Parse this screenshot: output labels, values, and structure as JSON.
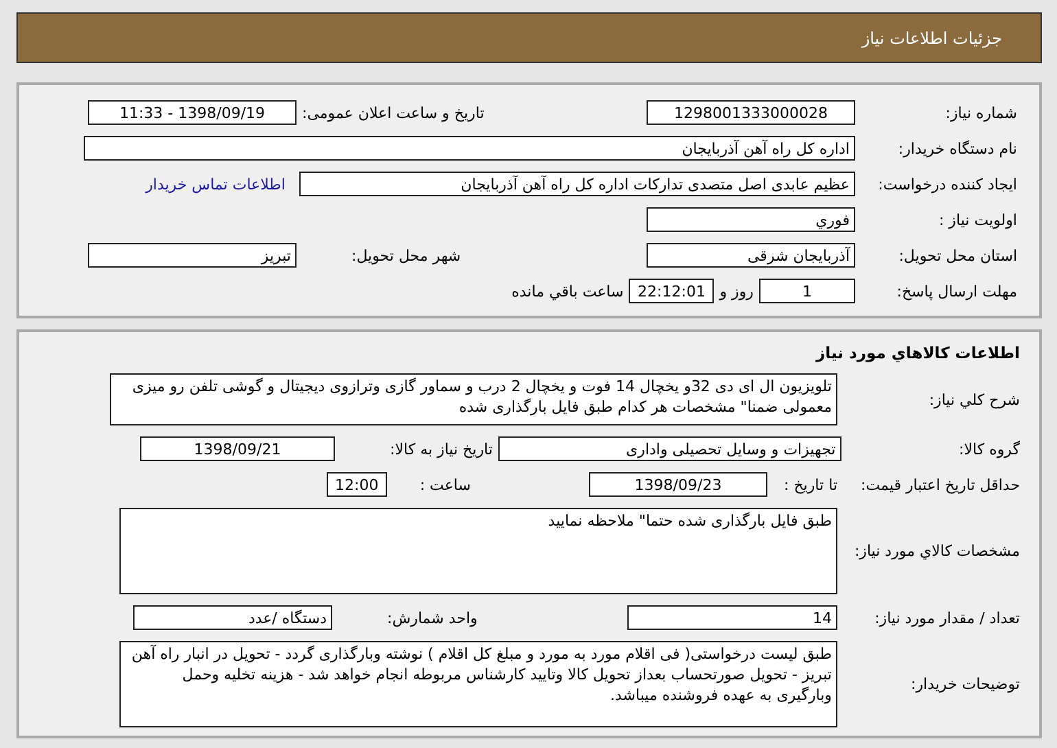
{
  "header": {
    "title": "جزئیات اطلاعات نیاز"
  },
  "need": {
    "number_label": "شماره نیاز:",
    "number": "1298001333000028",
    "announce_label": "تاریخ و ساعت اعلان عمومی:",
    "announce": "1398/09/19 - 11:33",
    "buyer_label": "نام دستگاه خریدار:",
    "buyer": "اداره کل راه آهن آذربایجان",
    "creator_label": "ایجاد کننده درخواست:",
    "creator": "عظیم عابدی اصل متصدی تدارکات اداره کل راه آهن آذربایجان",
    "contact_link": "اطلاعات تماس خریدار",
    "priority_label": "اولویت نیاز :",
    "priority": "فوري",
    "province_label": "استان محل تحویل:",
    "province": "آذربایجان شرقی",
    "city_label": "شهر محل تحویل:",
    "city": "تبریز",
    "deadline_label": "مهلت ارسال پاسخ:",
    "days": "1",
    "days_label": "روز و",
    "time": "22:12:01",
    "remaining_label": "ساعت باقي مانده"
  },
  "goods": {
    "title": "اطلاعات کالاهاي مورد نياز",
    "description_label": "شرح کلي نياز:",
    "description": "تلویزیون ال ای دی 32و یخچال 14 فوت و یخچال 2 درب و سماور گازی وترازوی دیجیتال و گوشی تلفن رو میزی معمولی ضمنا\" مشخصات هر کدام  طبق فایل بارگذاری شده",
    "group_label": "گروه کالا:",
    "group": "تجهیزات و وسایل تحصیلی واداری",
    "need_date_label": "تاریخ نیاز به کالا:",
    "need_date": "1398/09/21",
    "validity_label": "حداقل تاریخ اعتبار قیمت:",
    "until_label": "تا تاریخ :",
    "until_date": "1398/09/23",
    "hour_label": "ساعت :",
    "hour": "12:00",
    "specs_label": "مشخصات کالاي مورد نياز:",
    "specs": "طبق فایل بارگذاری شده حتما\" ملاحظه نمایید",
    "quantity_label": "تعداد / مقدار مورد نیاز:",
    "quantity": "14",
    "unit_label": "واحد شمارش:",
    "unit": "دستگاه /عدد",
    "notes_label": "توضیحات خریدار:",
    "notes": "طبق لیست درخواستی( فی اقلام  مورد به مورد و مبلغ کل اقلام  ) نوشته وبارگذاری گردد - تحویل در انبار راه آهن تبریز - تحویل صورتحساب بعداز تحویل کالا وتایید کارشناس مربوطه انجام خواهد شد - هزینه تخلیه وحمل وبارگیری به عهده فروشنده میباشد."
  }
}
